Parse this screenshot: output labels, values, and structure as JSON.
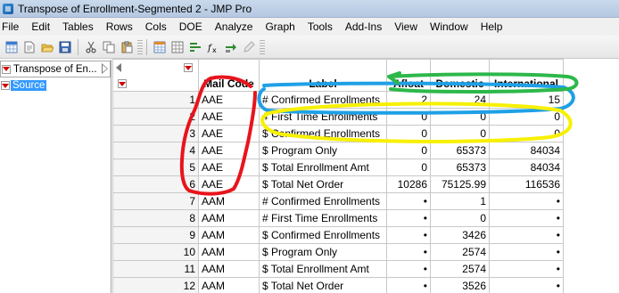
{
  "window": {
    "title": "Transpose of Enrollment-Segmented 2 - JMP Pro"
  },
  "menu": [
    "File",
    "Edit",
    "Tables",
    "Rows",
    "Cols",
    "DOE",
    "Analyze",
    "Graph",
    "Tools",
    "Add-Ins",
    "View",
    "Window",
    "Help"
  ],
  "toolbar": {
    "icons": [
      "new-table-icon",
      "new-script-icon",
      "open-icon",
      "save-icon",
      "cut-icon",
      "copy-icon",
      "paste-icon",
      "data-table-icon",
      "rows-icon",
      "distribution-icon",
      "formula-icon",
      "run-script-icon",
      "edit-icon"
    ]
  },
  "left_panel": {
    "table_name": "Transpose of En...",
    "columns_label": "Source"
  },
  "grid": {
    "columns": [
      "Mail Code",
      "Label",
      "Afloat",
      "Domestic",
      "International"
    ],
    "rows": [
      {
        "n": "1",
        "code": "AAE",
        "label": "# Confirmed Enrollments",
        "afloat": "2",
        "domestic": "24",
        "international": "15"
      },
      {
        "n": "2",
        "code": "AAE",
        "label": "# First Time Enrollments",
        "afloat": "0",
        "domestic": "0",
        "international": "0"
      },
      {
        "n": "3",
        "code": "AAE",
        "label": "$ Confirmed Enrollments",
        "afloat": "0",
        "domestic": "0",
        "international": "0"
      },
      {
        "n": "4",
        "code": "AAE",
        "label": "$ Program Only",
        "afloat": "0",
        "domestic": "65373",
        "international": "84034"
      },
      {
        "n": "5",
        "code": "AAE",
        "label": "$ Total Enrollment Amt",
        "afloat": "0",
        "domestic": "65373",
        "international": "84034"
      },
      {
        "n": "6",
        "code": "AAE",
        "label": "$ Total Net Order",
        "afloat": "10286",
        "domestic": "75125.99",
        "international": "116536"
      },
      {
        "n": "7",
        "code": "AAM",
        "label": "# Confirmed Enrollments",
        "afloat": "•",
        "domestic": "1",
        "international": "•"
      },
      {
        "n": "8",
        "code": "AAM",
        "label": "# First Time Enrollments",
        "afloat": "•",
        "domestic": "0",
        "international": "•"
      },
      {
        "n": "9",
        "code": "AAM",
        "label": "$ Confirmed Enrollments",
        "afloat": "•",
        "domestic": "3426",
        "international": "•"
      },
      {
        "n": "10",
        "code": "AAM",
        "label": "$ Program Only",
        "afloat": "•",
        "domestic": "2574",
        "international": "•"
      },
      {
        "n": "11",
        "code": "AAM",
        "label": "$ Total Enrollment Amt",
        "afloat": "•",
        "domestic": "2574",
        "international": "•"
      },
      {
        "n": "12",
        "code": "AAM",
        "label": "$ Total Net Order",
        "afloat": "•",
        "domestic": "3526",
        "international": "•"
      }
    ]
  },
  "annotations": {
    "red": "#e8141c",
    "blue": "#1fa0e6",
    "yellow": "#f7f000",
    "green": "#2db84a"
  }
}
